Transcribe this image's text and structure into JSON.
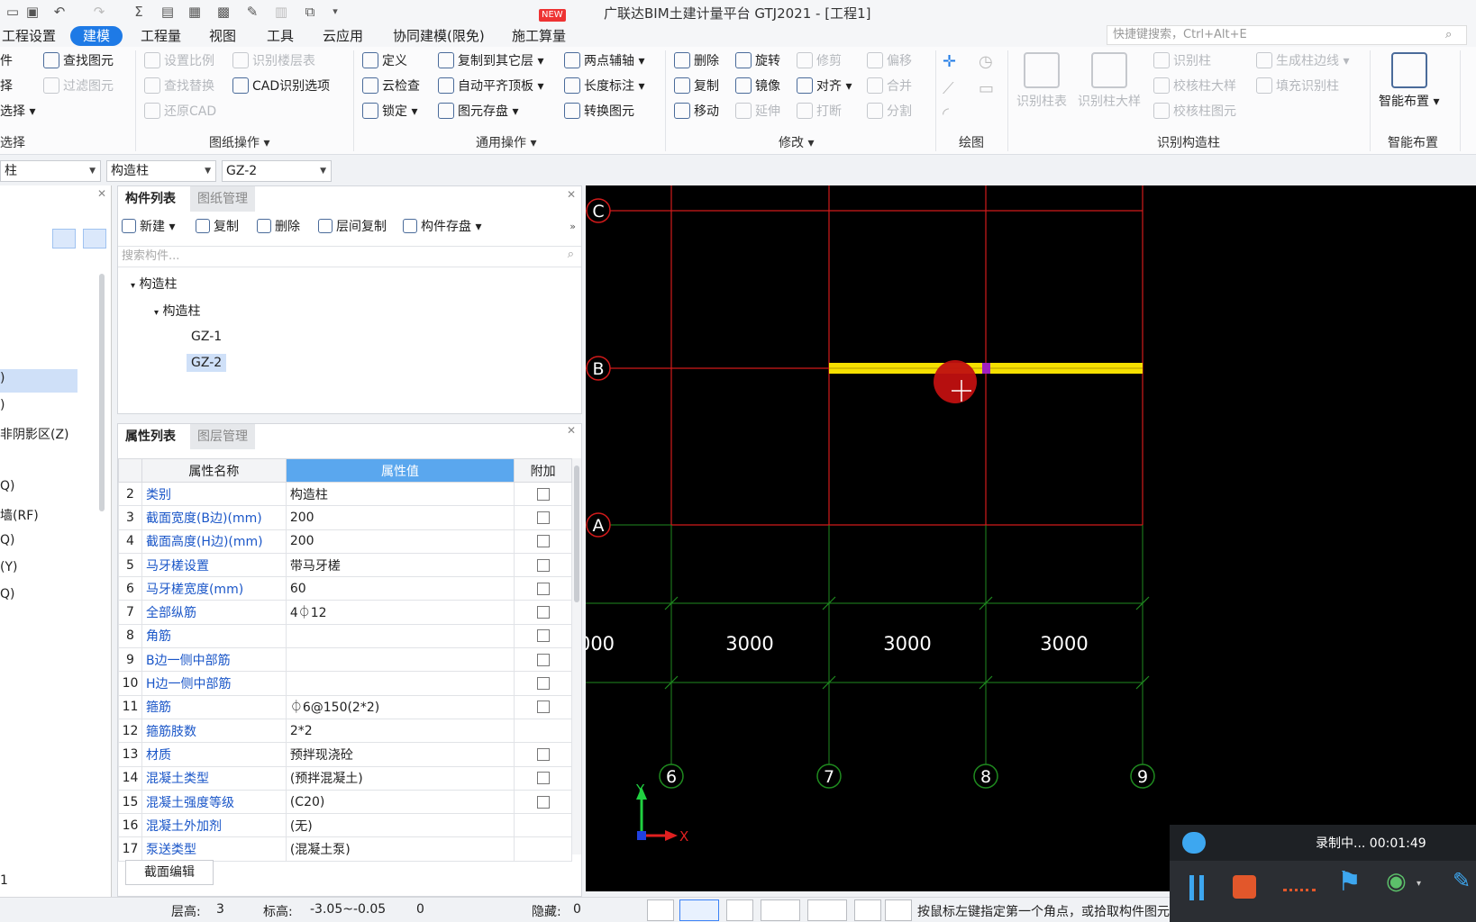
{
  "titlebar": {
    "title": "广联达BIM土建计量平台 GTJ2021 - [工程1]",
    "new_badge": "NEW"
  },
  "menu": {
    "items": [
      "工程设置",
      "建模",
      "工程量",
      "视图",
      "工具",
      "云应用",
      "协同建模(限免)",
      "施工算量"
    ],
    "active": "建模",
    "search_placeholder": "快捷键搜索，Ctrl+Alt+E"
  },
  "ribbon": {
    "select": {
      "items": [
        "件",
        "择",
        "选择"
      ],
      "label": "选择"
    },
    "drawing_ops": {
      "label": "图纸操作",
      "items": [
        "查找图元",
        "过滤图元",
        "设置比例",
        "识别楼层表",
        "查找替换",
        "CAD识别选项",
        "还原CAD"
      ]
    },
    "general_ops": {
      "label": "通用操作",
      "items": [
        "定义",
        "复制到其它层",
        "两点辅轴",
        "云检查",
        "自动平齐顶板",
        "长度标注",
        "锁定",
        "图元存盘",
        "转换图元"
      ]
    },
    "modify": {
      "label": "修改",
      "items": [
        "删除",
        "旋转",
        "修剪",
        "偏移",
        "复制",
        "镜像",
        "对齐",
        "合并",
        "移动",
        "延伸",
        "打断",
        "分割"
      ]
    },
    "draw": {
      "label": "绘图"
    },
    "recognize_column": {
      "label": "识别构造柱",
      "big": [
        "识别柱表",
        "识别柱大样"
      ],
      "items": [
        "识别柱",
        "生成柱边线",
        "校核柱大样",
        "填充识别柱",
        "校核柱图元"
      ]
    },
    "smart": {
      "label": "智能布置",
      "big": "智能布置"
    }
  },
  "selectors": {
    "floor": "柱",
    "type": "构造柱",
    "name": "GZ-2"
  },
  "left_panel": {
    "items": [
      ")",
      ")",
      "非阴影区(Z)",
      "Q)",
      "墙(RF)",
      "Q)",
      "(Y)",
      "Q)",
      "1"
    ]
  },
  "component_list": {
    "tabs": [
      "构件列表",
      "图纸管理"
    ],
    "toolbar": [
      "新建",
      "复制",
      "删除",
      "层间复制",
      "构件存盘"
    ],
    "search_placeholder": "搜索构件...",
    "tree": {
      "root": "构造柱",
      "child": "构造柱",
      "leaves": [
        "GZ-1",
        "GZ-2"
      ],
      "selected": "GZ-2"
    }
  },
  "property_list": {
    "tabs": [
      "属性列表",
      "图层管理"
    ],
    "headers": {
      "name": "属性名称",
      "value": "属性值",
      "extra": "附加"
    },
    "rows": [
      {
        "num": "2",
        "name": "类别",
        "value": "构造柱",
        "check": true
      },
      {
        "num": "3",
        "name": "截面宽度(B边)(mm)",
        "value": "200",
        "check": true
      },
      {
        "num": "4",
        "name": "截面高度(H边)(mm)",
        "value": "200",
        "check": true
      },
      {
        "num": "5",
        "name": "马牙槎设置",
        "value": "带马牙槎",
        "check": true
      },
      {
        "num": "6",
        "name": "马牙槎宽度(mm)",
        "value": "60",
        "check": true
      },
      {
        "num": "7",
        "name": "全部纵筋",
        "value": "4⏀12",
        "check": true
      },
      {
        "num": "8",
        "name": "角筋",
        "value": "",
        "check": true
      },
      {
        "num": "9",
        "name": "B边一侧中部筋",
        "value": "",
        "check": true
      },
      {
        "num": "10",
        "name": "H边一侧中部筋",
        "value": "",
        "check": true
      },
      {
        "num": "11",
        "name": "箍筋",
        "value": "⏀6@150(2*2)",
        "check": true
      },
      {
        "num": "12",
        "name": "箍筋肢数",
        "value": "2*2",
        "check": false
      },
      {
        "num": "13",
        "name": "材质",
        "value": "预拌现浇砼",
        "check": true
      },
      {
        "num": "14",
        "name": "混凝土类型",
        "value": "(预拌混凝土)",
        "check": true
      },
      {
        "num": "15",
        "name": "混凝土强度等级",
        "value": "(C20)",
        "check": true
      },
      {
        "num": "16",
        "name": "混凝土外加剂",
        "value": "(无)",
        "check": false
      },
      {
        "num": "17",
        "name": "泵送类型",
        "value": "(混凝土泵)",
        "check": false
      }
    ],
    "section_edit": "截面编辑"
  },
  "canvas": {
    "axis_rows": [
      "C",
      "B",
      "A"
    ],
    "axis_cols": [
      "6",
      "7",
      "8",
      "9"
    ],
    "dims": [
      "000",
      "3000",
      "3000",
      "3000"
    ],
    "ucs": {
      "x": "X",
      "y": "Y"
    },
    "colors": {
      "grid_red": "#d11a1a",
      "grid_green": "#1f8a1f",
      "beam_yellow": "#f5e000",
      "marker": "#c01010"
    }
  },
  "status": {
    "floor_height_label": "层高:",
    "floor_height": "3",
    "elev_label": "标高:",
    "elev": "-3.05~-0.05",
    "elev_extra": "0",
    "hidden_label": "隐藏:",
    "hidden": "0",
    "hint": "按鼠标左键指定第一个角点，或拾取构件图元"
  },
  "recorder": {
    "status": "录制中... 00:01:49"
  }
}
